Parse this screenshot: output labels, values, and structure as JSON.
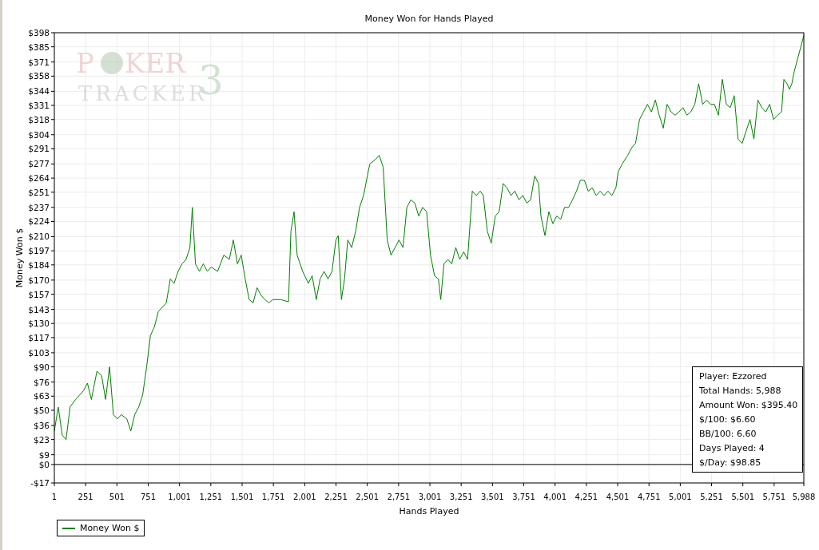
{
  "chart": {
    "logo": {
      "first": "P",
      "rest": "KER",
      "second": "TRACKER",
      "badge": "3"
    },
    "chart_data": {
      "type": "line",
      "title": "Money Won for Hands Played",
      "xlabel": "Hands Played",
      "ylabel": "Money Won $",
      "grid": true,
      "xlim": [
        1,
        5988
      ],
      "ylim": [
        -17,
        398
      ],
      "xticks": [
        {
          "value": 1,
          "label": "1"
        },
        {
          "value": 251,
          "label": "251"
        },
        {
          "value": 501,
          "label": "501"
        },
        {
          "value": 751,
          "label": "751"
        },
        {
          "value": 1001,
          "label": "1,001"
        },
        {
          "value": 1251,
          "label": "1,251"
        },
        {
          "value": 1501,
          "label": "1,501"
        },
        {
          "value": 1751,
          "label": "1,751"
        },
        {
          "value": 2001,
          "label": "2,001"
        },
        {
          "value": 2251,
          "label": "2,251"
        },
        {
          "value": 2501,
          "label": "2,501"
        },
        {
          "value": 2751,
          "label": "2,751"
        },
        {
          "value": 3001,
          "label": "3,001"
        },
        {
          "value": 3251,
          "label": "3,251"
        },
        {
          "value": 3501,
          "label": "3,501"
        },
        {
          "value": 3751,
          "label": "3,751"
        },
        {
          "value": 4001,
          "label": "4,001"
        },
        {
          "value": 4251,
          "label": "4,251"
        },
        {
          "value": 4501,
          "label": "4,501"
        },
        {
          "value": 4751,
          "label": "4,751"
        },
        {
          "value": 5001,
          "label": "5,001"
        },
        {
          "value": 5251,
          "label": "5,251"
        },
        {
          "value": 5501,
          "label": "5,501"
        },
        {
          "value": 5751,
          "label": "5,751"
        },
        {
          "value": 5988,
          "label": "5,988"
        }
      ],
      "yticks": [
        {
          "value": 398,
          "label": "$398"
        },
        {
          "value": 385,
          "label": "$385"
        },
        {
          "value": 371,
          "label": "$371"
        },
        {
          "value": 358,
          "label": "$358"
        },
        {
          "value": 344,
          "label": "$344"
        },
        {
          "value": 331,
          "label": "$331"
        },
        {
          "value": 318,
          "label": "$318"
        },
        {
          "value": 304,
          "label": "$304"
        },
        {
          "value": 291,
          "label": "$291"
        },
        {
          "value": 277,
          "label": "$277"
        },
        {
          "value": 264,
          "label": "$264"
        },
        {
          "value": 251,
          "label": "$251"
        },
        {
          "value": 237,
          "label": "$237"
        },
        {
          "value": 224,
          "label": "$224"
        },
        {
          "value": 210,
          "label": "$210"
        },
        {
          "value": 197,
          "label": "$197"
        },
        {
          "value": 184,
          "label": "$184"
        },
        {
          "value": 170,
          "label": "$170"
        },
        {
          "value": 157,
          "label": "$157"
        },
        {
          "value": 143,
          "label": "$143"
        },
        {
          "value": 130,
          "label": "$130"
        },
        {
          "value": 117,
          "label": "$117"
        },
        {
          "value": 103,
          "label": "$103"
        },
        {
          "value": 90,
          "label": "$90"
        },
        {
          "value": 76,
          "label": "$76"
        },
        {
          "value": 63,
          "label": "$63"
        },
        {
          "value": 50,
          "label": "$50"
        },
        {
          "value": 36,
          "label": "$36"
        },
        {
          "value": 23,
          "label": "$23"
        },
        {
          "value": 9,
          "label": "$9"
        },
        {
          "value": 0,
          "label": "$0"
        },
        {
          "value": -17,
          "label": "-$17"
        }
      ],
      "x": [
        1,
        32,
        64,
        95,
        127,
        171,
        234,
        265,
        297,
        341,
        379,
        410,
        442,
        473,
        505,
        536,
        580,
        612,
        643,
        675,
        706,
        738,
        769,
        801,
        832,
        864,
        895,
        927,
        958,
        990,
        1021,
        1053,
        1084,
        1103,
        1128,
        1160,
        1191,
        1223,
        1255,
        1305,
        1355,
        1399,
        1431,
        1463,
        1494,
        1526,
        1557,
        1589,
        1620,
        1652,
        1683,
        1715,
        1746,
        1809,
        1872,
        1891,
        1916,
        1941,
        1985,
        2030,
        2061,
        2093,
        2124,
        2156,
        2187,
        2219,
        2250,
        2269,
        2294,
        2319,
        2345,
        2376,
        2408,
        2439,
        2471,
        2502,
        2521,
        2565,
        2597,
        2628,
        2660,
        2691,
        2723,
        2754,
        2786,
        2817,
        2849,
        2880,
        2912,
        2943,
        2975,
        3006,
        3038,
        3069,
        3088,
        3113,
        3145,
        3176,
        3208,
        3239,
        3271,
        3302,
        3340,
        3372,
        3403,
        3428,
        3460,
        3491,
        3523,
        3554,
        3586,
        3617,
        3649,
        3680,
        3712,
        3743,
        3775,
        3806,
        3838,
        3869,
        3888,
        3920,
        3951,
        3983,
        4014,
        4046,
        4077,
        4109,
        4140,
        4172,
        4203,
        4235,
        4266,
        4298,
        4329,
        4361,
        4392,
        4424,
        4455,
        4487,
        4506,
        4537,
        4581,
        4613,
        4644,
        4676,
        4707,
        4739,
        4770,
        4802,
        4833,
        4865,
        4896,
        4928,
        4959,
        4991,
        5022,
        5054,
        5085,
        5117,
        5148,
        5180,
        5211,
        5243,
        5274,
        5306,
        5337,
        5369,
        5400,
        5432,
        5463,
        5495,
        5526,
        5558,
        5589,
        5621,
        5652,
        5684,
        5715,
        5747,
        5778,
        5810,
        5829,
        5854,
        5873,
        5892,
        5911,
        5988
      ],
      "series": [
        {
          "name": "Money Won $",
          "color": "#008000",
          "values": [
            31,
            53,
            27,
            23,
            53,
            60,
            68,
            75,
            60,
            86,
            82,
            60,
            90,
            46,
            42,
            46,
            42,
            31,
            46,
            53,
            64,
            90,
            119,
            127,
            141,
            145,
            149,
            171,
            167,
            178,
            185,
            189,
            200,
            237,
            185,
            178,
            185,
            178,
            182,
            178,
            193,
            189,
            207,
            185,
            193,
            171,
            152,
            149,
            163,
            156,
            152,
            149,
            152,
            152,
            150,
            215,
            233,
            193,
            178,
            167,
            174,
            152,
            171,
            178,
            171,
            178,
            207,
            211,
            152,
            171,
            207,
            200,
            215,
            237,
            248,
            266,
            277,
            281,
            285,
            274,
            207,
            193,
            200,
            207,
            200,
            237,
            244,
            241,
            229,
            237,
            233,
            193,
            174,
            171,
            152,
            185,
            189,
            185,
            200,
            189,
            196,
            189,
            252,
            248,
            252,
            248,
            215,
            204,
            229,
            233,
            259,
            255,
            248,
            252,
            244,
            248,
            241,
            244,
            266,
            259,
            229,
            211,
            233,
            222,
            229,
            226,
            237,
            237,
            244,
            252,
            262,
            262,
            252,
            255,
            248,
            252,
            248,
            252,
            248,
            255,
            270,
            277,
            285,
            292,
            296,
            318,
            325,
            332,
            325,
            336,
            322,
            310,
            332,
            325,
            322,
            325,
            329,
            322,
            325,
            332,
            351,
            332,
            336,
            332,
            332,
            322,
            355,
            332,
            329,
            340,
            300,
            296,
            307,
            318,
            300,
            336,
            329,
            325,
            332,
            318,
            322,
            325,
            355,
            351,
            346,
            351,
            362,
            395.4
          ]
        }
      ]
    }
  },
  "stats": [
    "Player: Ezzored",
    "Total Hands: 5,988",
    "Amount Won: $395.40",
    "$/100: $6.60",
    "BB/100: 6.60",
    "Days Played: 4",
    "$/Day: $98.85"
  ]
}
